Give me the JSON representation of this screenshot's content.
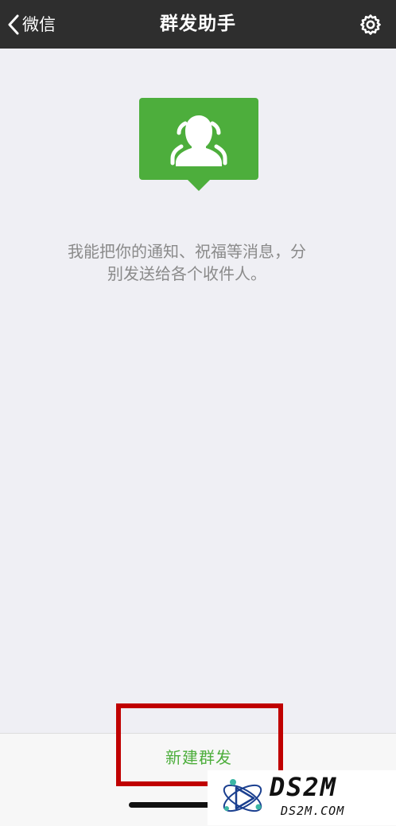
{
  "navbar": {
    "back_label": "微信",
    "title": "群发助手"
  },
  "main": {
    "description": "我能把你的通知、祝福等消息，分别发送给各个收件人。"
  },
  "bottom": {
    "new_broadcast_label": "新建群发"
  },
  "watermark": {
    "main": "DS2M",
    "sub": "DS2M.COM"
  },
  "colors": {
    "nav_background": "#2E2E2E",
    "page_background": "#EFEFF4",
    "accent_green": "#4DAE3C",
    "highlight_red": "#C00000"
  },
  "icons": {
    "back": "chevron-left-icon",
    "settings": "gear-icon",
    "hero": "group-contacts-icon"
  }
}
